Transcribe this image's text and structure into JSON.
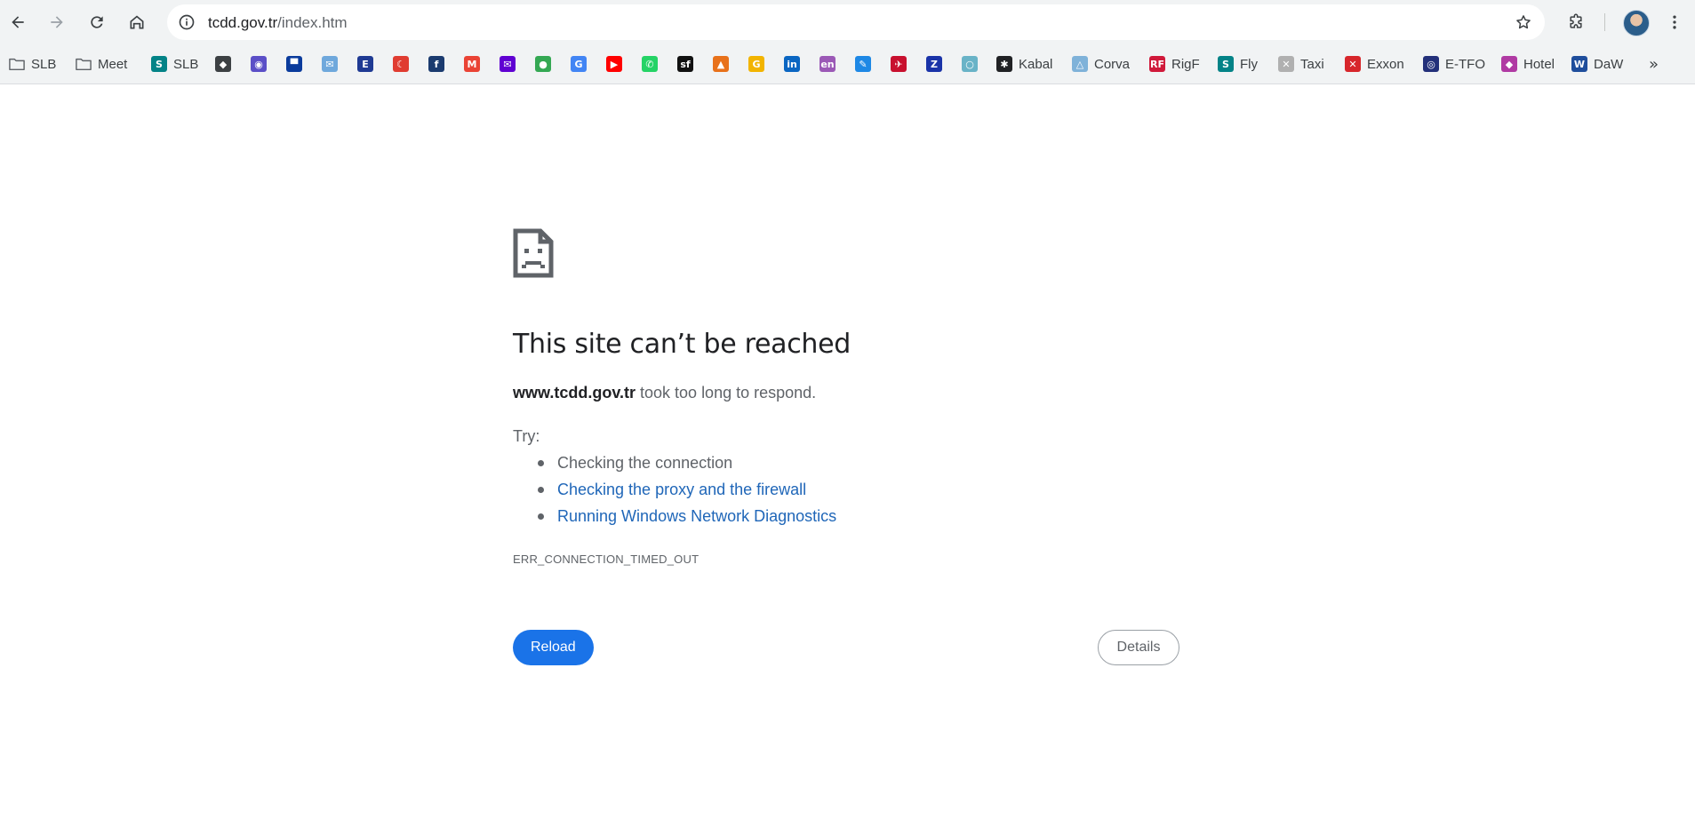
{
  "browser": {
    "url_host": "tcdd.gov.tr",
    "url_path": "/index.htm"
  },
  "bookmarks": [
    {
      "label": "SLB",
      "icon": "folder-icon",
      "color": "#5f6368",
      "glyph": ""
    },
    {
      "label": "Meet",
      "icon": "folder-icon",
      "color": "#5f6368",
      "glyph": ""
    },
    {
      "label": "SLB",
      "icon": "sharepoint-icon",
      "color": "#038387",
      "glyph": "S"
    },
    {
      "label": "",
      "icon": "app-icon",
      "color": "#3c4043",
      "glyph": "◆"
    },
    {
      "label": "",
      "icon": "globe-icon",
      "color": "#5b4fc7",
      "glyph": "◉"
    },
    {
      "label": "",
      "icon": "site-icon",
      "color": "#0a3b9c",
      "glyph": "▀"
    },
    {
      "label": "",
      "icon": "mail-app-icon",
      "color": "#6fa8dc",
      "glyph": "✉"
    },
    {
      "label": "",
      "icon": "e-icon",
      "color": "#1f3a93",
      "glyph": "E"
    },
    {
      "label": "",
      "icon": "turkey-flag-icon",
      "color": "#e03c31",
      "glyph": "☾"
    },
    {
      "label": "",
      "icon": "f-icon",
      "color": "#1b3b6f",
      "glyph": "f"
    },
    {
      "label": "",
      "icon": "gmail-icon",
      "color": "#ea4335",
      "glyph": "M"
    },
    {
      "label": "",
      "icon": "yahoo-mail-icon",
      "color": "#6001d2",
      "glyph": "✉"
    },
    {
      "label": "",
      "icon": "maps-icon",
      "color": "#34a853",
      "glyph": "●"
    },
    {
      "label": "",
      "icon": "translate-icon",
      "color": "#4285f4",
      "glyph": "G"
    },
    {
      "label": "",
      "icon": "youtube-icon",
      "color": "#ff0000",
      "glyph": "▶"
    },
    {
      "label": "",
      "icon": "whatsapp-icon",
      "color": "#25d366",
      "glyph": "✆"
    },
    {
      "label": "",
      "icon": "sf-icon",
      "color": "#111111",
      "glyph": "sf"
    },
    {
      "label": "",
      "icon": "mountain-icon",
      "color": "#e8711a",
      "glyph": "▲"
    },
    {
      "label": "",
      "icon": "g-icon",
      "color": "#f2b400",
      "glyph": "G"
    },
    {
      "label": "",
      "icon": "linkedin-icon",
      "color": "#0a66c2",
      "glyph": "in"
    },
    {
      "label": "",
      "icon": "en-icon",
      "color": "#9b59b6",
      "glyph": "en"
    },
    {
      "label": "",
      "icon": "feather-icon",
      "color": "#1e88e5",
      "glyph": "✎"
    },
    {
      "label": "",
      "icon": "turkish-airlines-icon",
      "color": "#c8102e",
      "glyph": "✈"
    },
    {
      "label": "",
      "icon": "z-icon",
      "color": "#1a33a8",
      "glyph": "Z"
    },
    {
      "label": "",
      "icon": "circle-app-icon",
      "color": "#69b3c7",
      "glyph": "○"
    },
    {
      "label": "Kabal",
      "icon": "kabal-icon",
      "color": "#202124",
      "glyph": "✱"
    },
    {
      "label": "Corva",
      "icon": "corva-icon",
      "color": "#7fb2d9",
      "glyph": "△"
    },
    {
      "label": "RigF",
      "icon": "rigf-icon",
      "color": "#d0193a",
      "glyph": "RF"
    },
    {
      "label": "Fly",
      "icon": "sharepoint-icon",
      "color": "#038387",
      "glyph": "S"
    },
    {
      "label": "Taxi",
      "icon": "taxi-icon",
      "color": "#b0b0b0",
      "glyph": "✕"
    },
    {
      "label": "Exxon",
      "icon": "exxon-icon",
      "color": "#d7262b",
      "glyph": "✕"
    },
    {
      "label": "E-TFO",
      "icon": "etfo-icon",
      "color": "#23307a",
      "glyph": "◎"
    },
    {
      "label": "Hotel",
      "icon": "hotel-icon",
      "color": "#b03aa3",
      "glyph": "◆"
    },
    {
      "label": "DaW",
      "icon": "daw-icon",
      "color": "#1f4e9c",
      "glyph": "W"
    }
  ],
  "error_page": {
    "title": "This site can’t be reached",
    "host": "www.tcdd.gov.tr",
    "message": "took too long to respond.",
    "try_label": "Try:",
    "suggestions": [
      {
        "text": "Checking the connection",
        "link": false
      },
      {
        "text": "Checking the proxy and the firewall",
        "link": true
      },
      {
        "text": "Running Windows Network Diagnostics",
        "link": true
      }
    ],
    "error_code": "ERR_CONNECTION_TIMED_OUT",
    "reload_label": "Reload",
    "details_label": "Details"
  },
  "colors": {
    "accent": "#1a73e8",
    "link": "#1f66b8",
    "toolbar_bg": "#f1f3f4"
  }
}
